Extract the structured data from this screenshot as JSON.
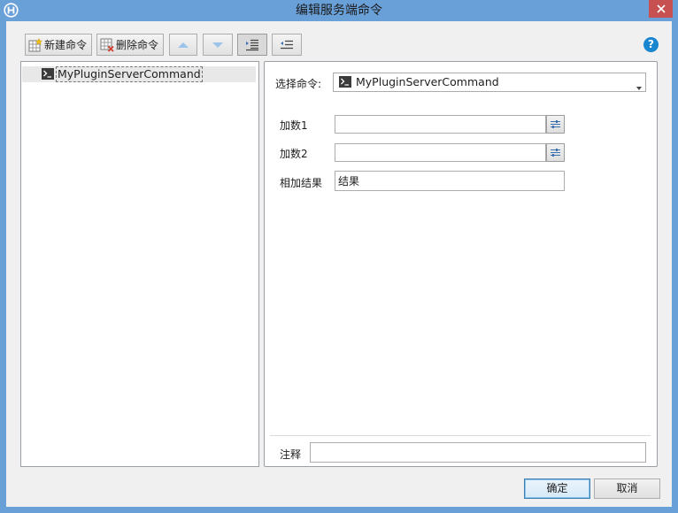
{
  "window": {
    "title": "编辑服务端命令"
  },
  "toolbar": {
    "new_label": "新建命令",
    "delete_label": "删除命令",
    "help_glyph": "?"
  },
  "tree": {
    "items": [
      {
        "label": "MyPluginServerCommand",
        "icon": "terminal-icon"
      }
    ]
  },
  "form": {
    "select_label": "选择命令:",
    "select_value": "MyPluginServerCommand",
    "fields": [
      {
        "label": "加数1",
        "value": ""
      },
      {
        "label": "加数2",
        "value": ""
      },
      {
        "label": "相加结果",
        "value": "结果"
      }
    ],
    "comment_label": "注释",
    "comment_value": ""
  },
  "footer": {
    "ok_label": "确定",
    "cancel_label": "取消"
  },
  "colors": {
    "frame": "#6aa0d8",
    "close": "#c75050",
    "help": "#1a86d0",
    "default_button_border": "#3c7fb1"
  }
}
